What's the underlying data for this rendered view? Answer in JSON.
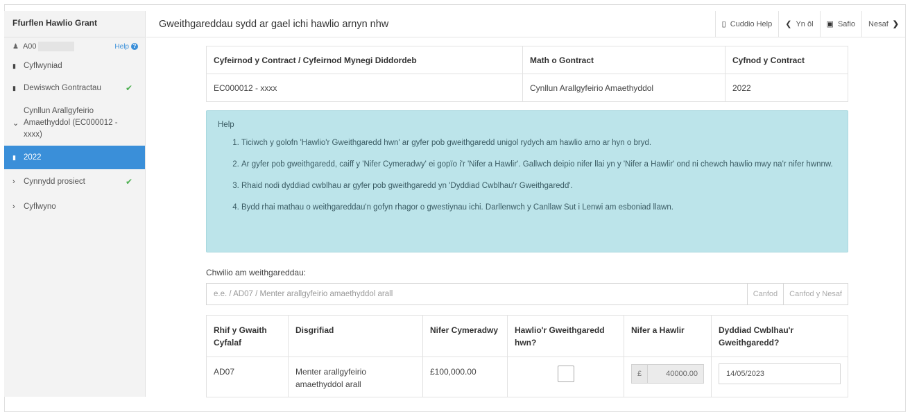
{
  "sidebar": {
    "title": "Ffurflen Hawlio Grant",
    "user_id": "A00",
    "help_label": "Help",
    "items": [
      {
        "label": "Cyflwyniad",
        "icon": "file-icon",
        "checked": false
      },
      {
        "label": "Dewiswch Gontractau",
        "icon": "file-icon",
        "checked": true
      },
      {
        "label": "Cynllun Arallgyfeirio Amaethyddol (EC000012 - xxxx)",
        "icon": "chevron-down-icon",
        "checked": false
      },
      {
        "label": "2022",
        "icon": "file-icon",
        "checked": false,
        "active": true
      },
      {
        "label": "Cynnydd prosiect",
        "icon": "chevron-right-icon",
        "checked": true
      },
      {
        "label": "Cyflwyno",
        "icon": "chevron-right-icon",
        "checked": false
      }
    ]
  },
  "topbar": {
    "title": "Gweithgareddau sydd ar gael ichi hawlio arnyn nhw",
    "hide_help": "Cuddio Help",
    "back": "Yn ôl",
    "save": "Safio",
    "next": "Nesaf"
  },
  "contract_table": {
    "headers": [
      "Cyfeirnod y Contract / Cyfeirnod Mynegi Diddordeb",
      "Math o Gontract",
      "Cyfnod y Contract"
    ],
    "row": [
      "EC000012 - xxxx",
      "Cynllun Arallgyfeirio Amaethyddol",
      "2022"
    ]
  },
  "help_box": {
    "title": "Help",
    "items": [
      "Ticiwch y golofn 'Hawlio'r Gweithgaredd hwn' ar gyfer pob gweithgaredd unigol rydych am hawlio arno ar hyn o bryd.",
      "Ar gyfer pob gweithgaredd, caiff y 'Nifer Cymeradwy' ei gopïo i'r 'Nifer a Hawlir'. Gallwch deipio nifer llai yn y 'Nifer a Hawlir' ond ni chewch hawlio mwy na'r nifer hwnnw.",
      "Rhaid nodi dyddiad cwblhau ar gyfer pob gweithgaredd yn 'Dyddiad Cwblhau'r Gweithgaredd'.",
      "Bydd rhai mathau o weithgareddau'n gofyn rhagor o gwestiynau ichi. Darllenwch y Canllaw Sut i Lenwi am esboniad llawn."
    ]
  },
  "search": {
    "label": "Chwilio am weithgareddau:",
    "placeholder": "e.e. / AD07 / Menter arallgyfeirio amaethyddol arall",
    "find": "Canfod",
    "find_next": "Canfod y Nesaf"
  },
  "activities": {
    "headers": [
      "Rhif y Gwaith Cyfalaf",
      "Disgrifiad",
      "Nifer Cymeradwy",
      "Hawlio'r Gweithgaredd hwn?",
      "Nifer a Hawlir",
      "Dyddiad Cwblhau'r Gweithgaredd?"
    ],
    "rows": [
      {
        "code": "AD07",
        "description": "Menter arallgyfeirio amaethyddol arall",
        "approved": "£100,000.00",
        "claim_checked": false,
        "currency": "£",
        "claimed": "40000.00",
        "completion_date": "14/05/2023"
      }
    ]
  }
}
